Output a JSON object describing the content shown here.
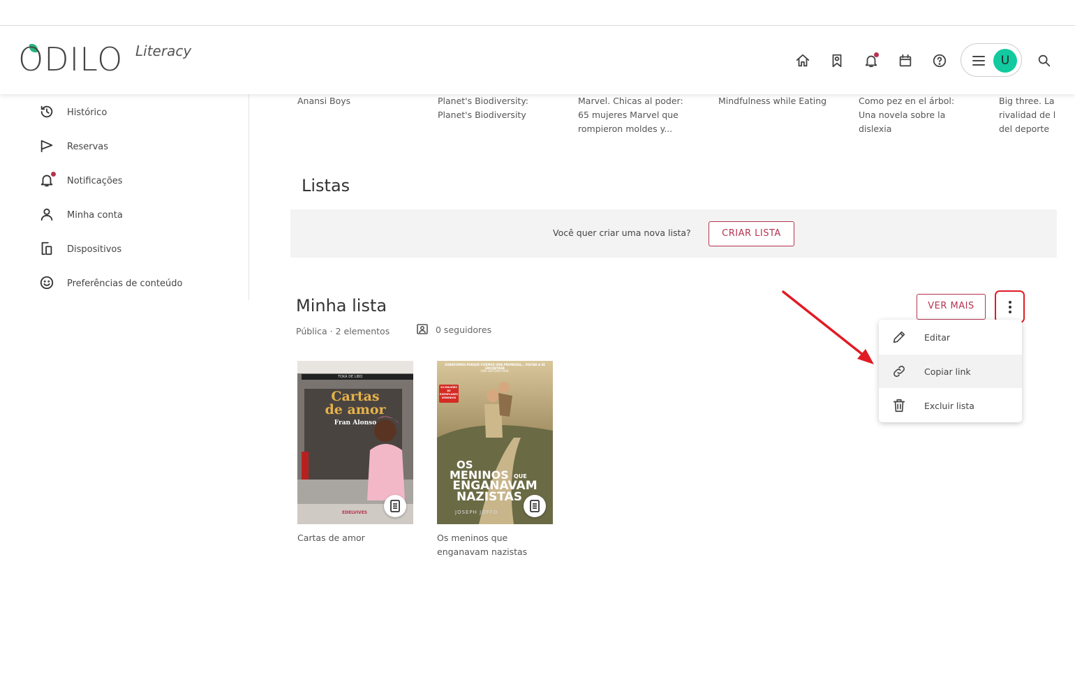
{
  "header": {
    "logo_main": "ODILO",
    "logo_sub": "Literacy",
    "avatar_initial": "U"
  },
  "sidebar": {
    "items": [
      {
        "label": "Histórico",
        "icon": "history-icon"
      },
      {
        "label": "Reservas",
        "icon": "flag-icon"
      },
      {
        "label": "Notificações",
        "icon": "bell-icon"
      },
      {
        "label": "Minha conta",
        "icon": "user-icon"
      },
      {
        "label": "Dispositivos",
        "icon": "devices-icon"
      },
      {
        "label": "Preferências de conteúdo",
        "icon": "smiley-icon"
      }
    ]
  },
  "carousel": {
    "titles": [
      "Anansi Boys",
      "Planet's Biodiversity: Planet's Biodiversity",
      "Marvel. Chicas al poder: 65 mujeres Marvel que rompieron moldes y...",
      "Mindfulness while Eating",
      "Como pez en el árbol: Una novela sobre la dislexia",
      "Big three. La rivalidad de l del deporte"
    ]
  },
  "lists": {
    "section_title": "Listas",
    "create_prompt": "Você quer criar uma nova lista?",
    "create_button": "CRIAR LISTA"
  },
  "my_list": {
    "title": "Minha lista",
    "meta": "Pública · 2 elementos",
    "followers": "0 seguidores",
    "more_button": "VER MAIS",
    "menu": [
      {
        "label": "Editar",
        "icon": "pencil-icon"
      },
      {
        "label": "Copiar link",
        "icon": "link-icon"
      },
      {
        "label": "Excluir lista",
        "icon": "trash-icon"
      }
    ],
    "books": [
      {
        "caption": "Cartas de amor",
        "cover_title_line1": "Cartas",
        "cover_title_line2": "de amor",
        "cover_author": "Fran Alonso",
        "cover_series": "TOKA DE LIBO",
        "cover_publisher": "EDELVIVES"
      },
      {
        "caption": "Os meninos que enganavam nazistas",
        "cover_title_line1": "OS",
        "cover_title_line2": "MENINOS",
        "cover_title_que": "QUE",
        "cover_title_line3": "ENGANAVAM",
        "cover_title_line4": "NAZISTAS",
        "cover_author": "JOSEPH JOFFO",
        "cover_top_text": "SOBREVIMOS PORQUE FIZEMOS UMA PROMESSA... VOLTAR A SE ENCONTRAR",
        "cover_top_sub": "UMA HISTÓRIA REAL",
        "cover_badge": "20 MILHÕES DE EXEMPLARES VENDIDOS"
      }
    ]
  },
  "colors": {
    "accent": "#b5334f",
    "avatar": "#12c9a0",
    "highlight": "#e01b24"
  }
}
